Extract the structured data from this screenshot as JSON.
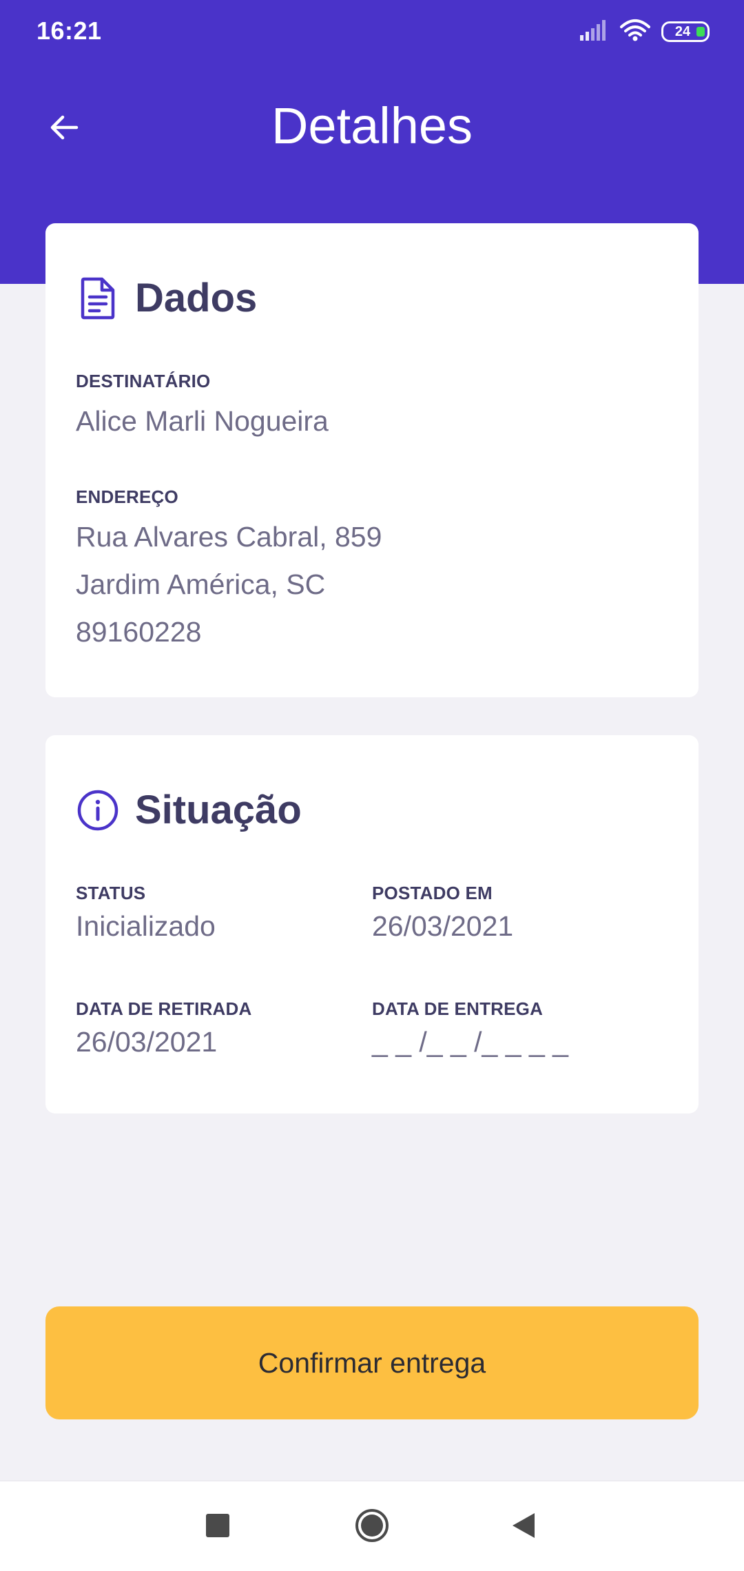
{
  "status_bar": {
    "time": "16:21",
    "battery": "24"
  },
  "app_bar": {
    "title": "Detalhes"
  },
  "dados": {
    "title": "Dados",
    "recipient_label": "DESTINATÁRIO",
    "recipient_value": "Alice Marli Nogueira",
    "address_label": "ENDEREÇO",
    "address_line1": "Rua Alvares Cabral, 859",
    "address_line2": "Jardim América, SC",
    "address_line3": "89160228"
  },
  "situacao": {
    "title": "Situação",
    "status_label": "STATUS",
    "status_value": "Inicializado",
    "posted_label": "POSTADO EM",
    "posted_value": "26/03/2021",
    "pickup_label": "DATA DE RETIRADA",
    "pickup_value": "26/03/2021",
    "delivery_label": "DATA DE ENTREGA",
    "delivery_value": "_ _ /_ _ /_ _ _ _"
  },
  "actions": {
    "confirm_label": "Confirmar entrega"
  },
  "colors": {
    "primary": "#4A33C9",
    "accent": "#FDBF41",
    "background": "#F2F1F6",
    "heading": "#3E3B63",
    "text_muted": "#6E6B87"
  },
  "icons": [
    "arrow-left-icon",
    "file-text-icon",
    "info-icon",
    "signal-icon",
    "wifi-icon",
    "battery-icon",
    "nav-recent-icon",
    "nav-home-icon",
    "nav-back-icon"
  ]
}
